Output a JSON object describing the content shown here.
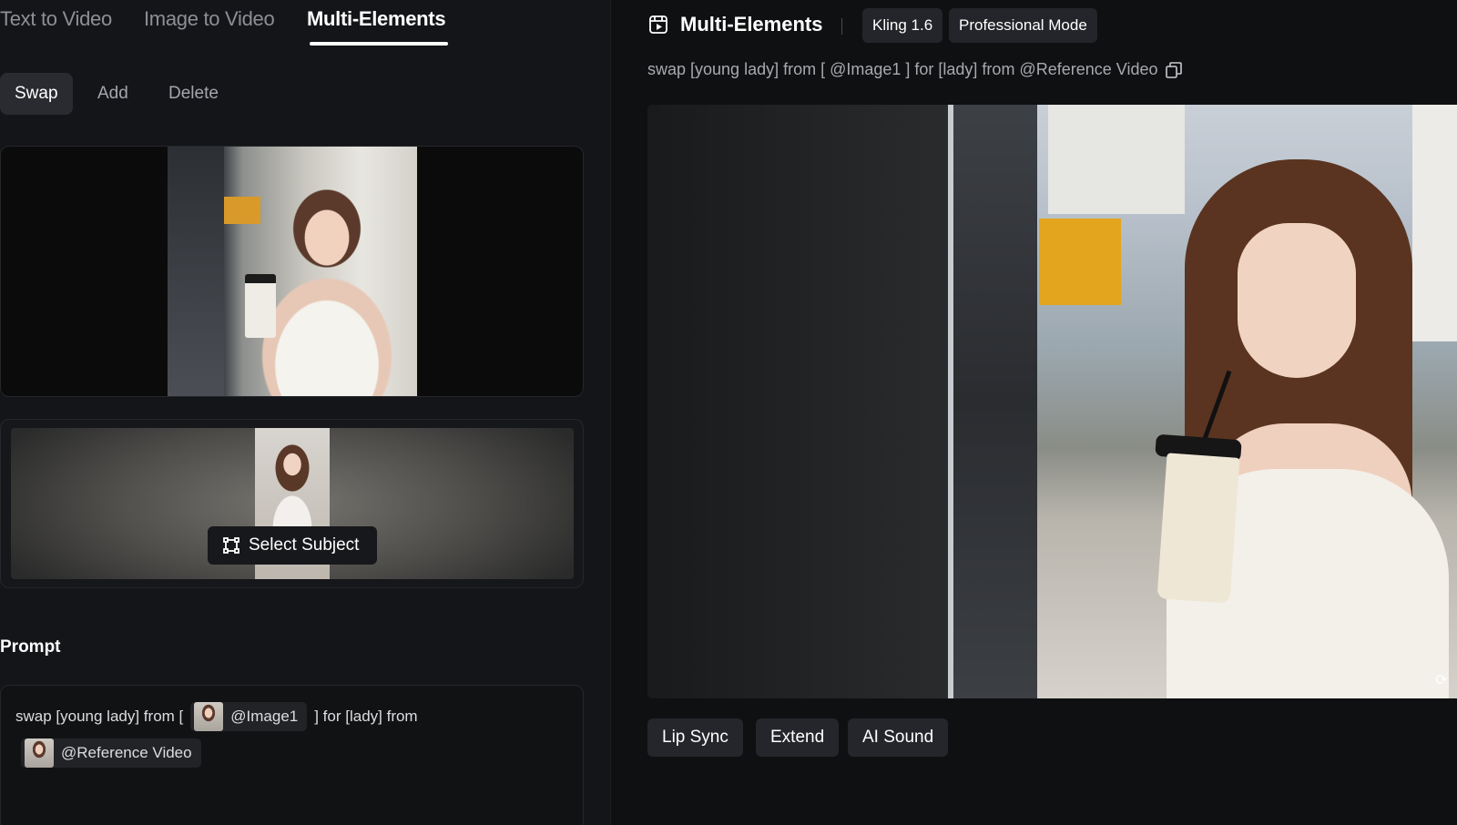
{
  "tabs": [
    {
      "label": "Text to Video"
    },
    {
      "label": "Image to Video"
    },
    {
      "label": "Multi-Elements"
    }
  ],
  "active_tab": "Multi-Elements",
  "subtabs": [
    {
      "label": "Swap"
    },
    {
      "label": "Add"
    },
    {
      "label": "Delete"
    }
  ],
  "active_subtab": "Swap",
  "subject": {
    "select_label": "Select Subject"
  },
  "prompt": {
    "label": "Prompt",
    "part1": "swap [young lady] from [",
    "chip1": "@Image1",
    "part2": "] for [lady] from",
    "chip2": "@Reference Video"
  },
  "result": {
    "title": "Multi-Elements",
    "model_badge": "Kling 1.6",
    "mode_badge": "Professional Mode",
    "prompt_text": "swap [young lady] from [ @Image1 ] for [lady] from @Reference Video"
  },
  "actions": [
    {
      "label": "Lip Sync"
    },
    {
      "label": "Extend"
    },
    {
      "label": "AI Sound"
    }
  ],
  "icons": {
    "select_subject": "frame-select-icon",
    "header": "film-icon",
    "copy": "copy-icon",
    "refresh": "refresh-icon"
  },
  "colors": {
    "left_bg": "#141518",
    "right_bg": "#0f1012",
    "chip_bg": "#222327",
    "button_bg": "#25262b"
  }
}
